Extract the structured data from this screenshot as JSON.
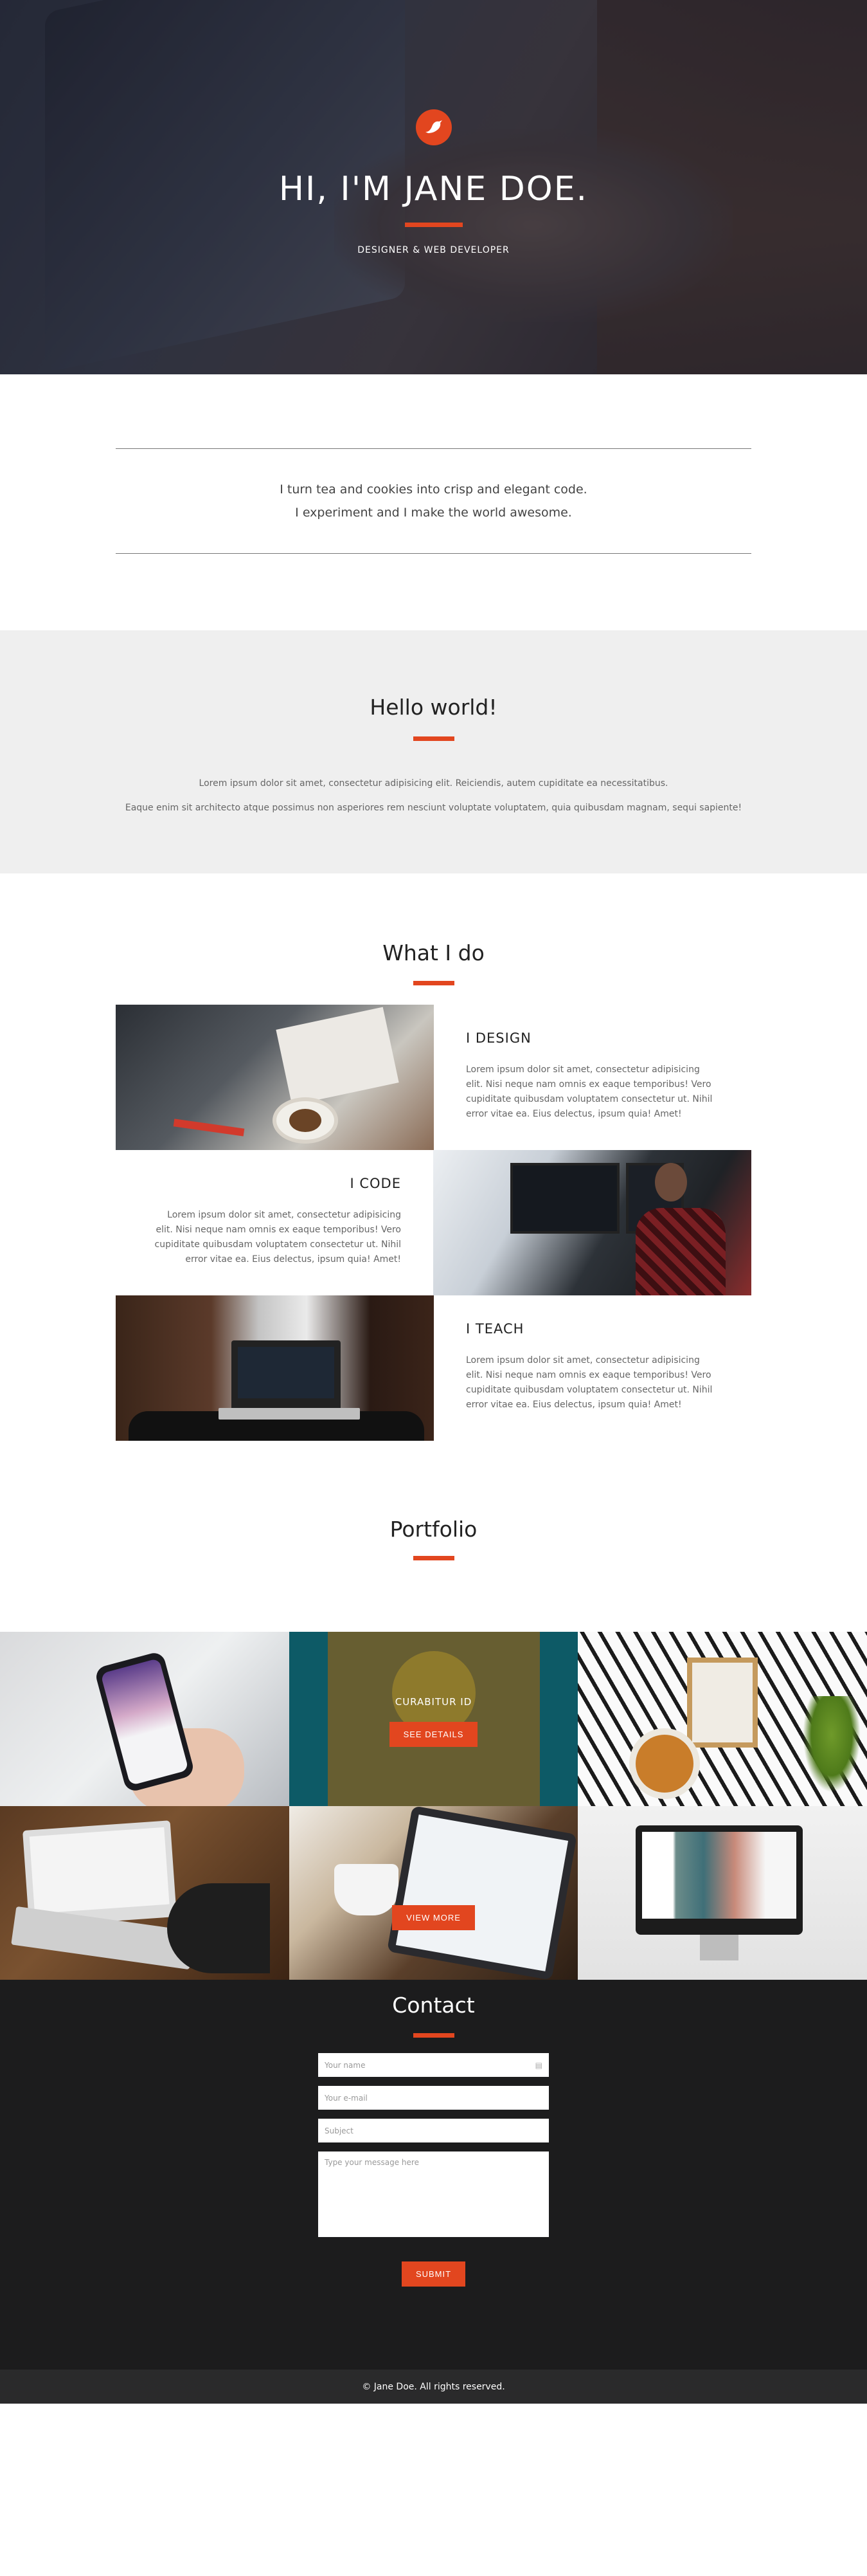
{
  "hero": {
    "name": "HI, I'M JANE DOE.",
    "subtitle": "DESIGNER & WEB DEVELOPER"
  },
  "intro": {
    "line1": "I turn tea and cookies into crisp and elegant code.",
    "line2": "I experiment and I make the world awesome."
  },
  "hello": {
    "title": "Hello world!",
    "para1": "Lorem ipsum dolor sit amet, consectetur adipisicing elit. Reiciendis, autem cupiditate ea necessitatibus.",
    "para2": "Eaque enim sit architecto atque possimus non asperiores rem nesciunt voluptate voluptatem, quia quibusdam magnam, sequi sapiente!"
  },
  "whatido": {
    "title": "What I do",
    "services": [
      {
        "title": "I DESIGN",
        "text": "Lorem ipsum dolor sit amet, consectetur adipisicing elit. Nisi neque nam omnis ex eaque temporibus! Vero cupiditate quibusdam voluptatem consectetur ut. Nihil error vitae ea. Eius delectus, ipsum quia! Amet!"
      },
      {
        "title": "I CODE",
        "text": "Lorem ipsum dolor sit amet, consectetur adipisicing elit. Nisi neque nam omnis ex eaque temporibus! Vero cupiditate quibusdam voluptatem consectetur ut. Nihil error vitae ea. Eius delectus, ipsum quia! Amet!"
      },
      {
        "title": "I TEACH",
        "text": "Lorem ipsum dolor sit amet, consectetur adipisicing elit. Nisi neque nam omnis ex eaque temporibus! Vero cupiditate quibusdam voluptatem consectetur ut. Nihil error vitae ea. Eius delectus, ipsum quia! Amet!"
      }
    ]
  },
  "portfolio": {
    "title": "Portfolio",
    "hover_caption": "CURABITUR ID",
    "details_button": "SEE DETAILS",
    "view_more": "VIEW MORE"
  },
  "contact": {
    "title": "Contact",
    "name_placeholder": "Your name",
    "email_placeholder": "Your e-mail",
    "subject_placeholder": "Subject",
    "message_placeholder": "Type your message here",
    "submit": "SUBMIT"
  },
  "footer": {
    "text": "© Jane Doe. All rights reserved."
  },
  "colors": {
    "accent": "#e2461f",
    "contact_bg": "#1c1c1d",
    "footer_bg": "#2a2a2b",
    "hello_bg": "#efefef"
  }
}
